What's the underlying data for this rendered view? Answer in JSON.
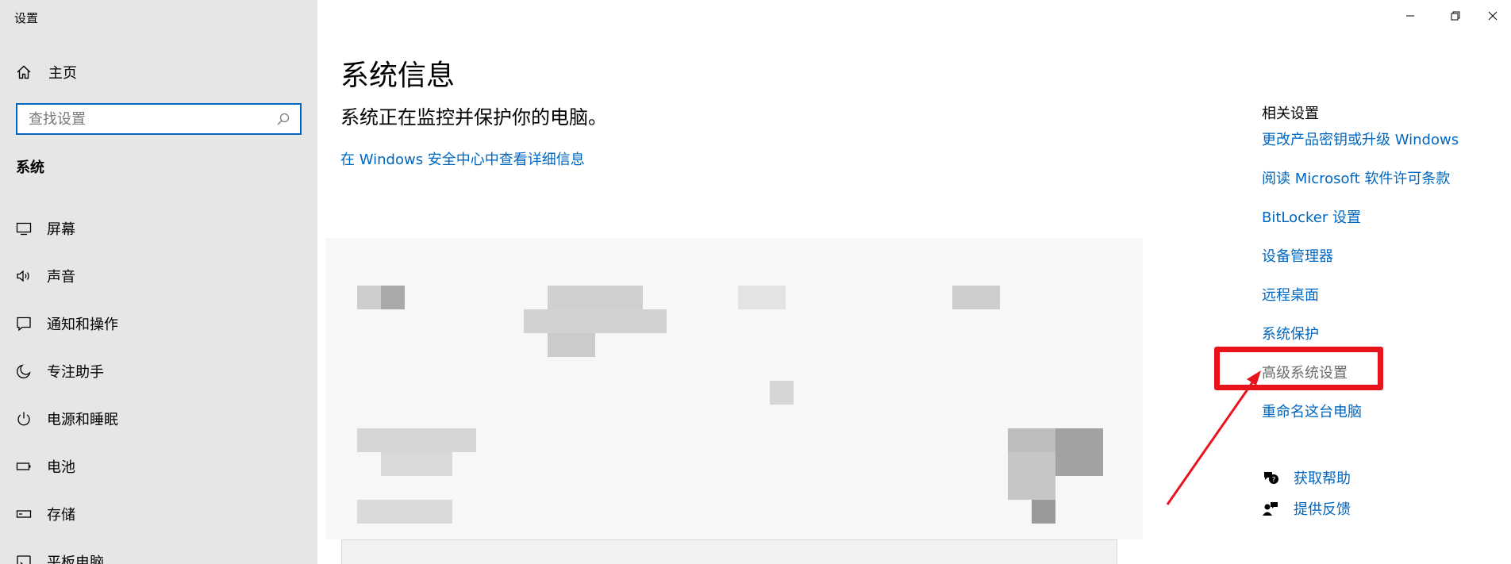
{
  "window": {
    "title": "设置",
    "controls": {
      "minimize": "minimize-icon",
      "restore": "restore-icon",
      "close": "close-icon"
    }
  },
  "sidebar": {
    "home_label": "主页",
    "search": {
      "placeholder": "查找设置",
      "value": ""
    },
    "section_label": "系统",
    "items": [
      {
        "label": "屏幕",
        "icon": "monitor-icon"
      },
      {
        "label": "声音",
        "icon": "speaker-icon"
      },
      {
        "label": "通知和操作",
        "icon": "notification-icon"
      },
      {
        "label": "专注助手",
        "icon": "moon-icon"
      },
      {
        "label": "电源和睡眠",
        "icon": "power-icon"
      },
      {
        "label": "电池",
        "icon": "battery-icon"
      },
      {
        "label": "存储",
        "icon": "storage-icon"
      },
      {
        "label": "平板电脑",
        "icon": "tablet-icon"
      }
    ]
  },
  "main": {
    "title": "系统信息",
    "subtitle": "系统正在监控并保护你的电脑。",
    "security_link": "在 Windows 安全中心中查看详细信息"
  },
  "related": {
    "title": "相关设置",
    "links": [
      "更改产品密钥或升级 Windows",
      "阅读 Microsoft 软件许可条款",
      "BitLocker 设置",
      "设备管理器",
      "远程桌面",
      "系统保护",
      "高级系统设置",
      "重命名这台电脑"
    ],
    "help": "获取帮助",
    "feedback": "提供反馈"
  },
  "colors": {
    "accent": "#0067c0",
    "annotation": "#e8141c",
    "sidebar_bg": "#e6e6e6"
  }
}
